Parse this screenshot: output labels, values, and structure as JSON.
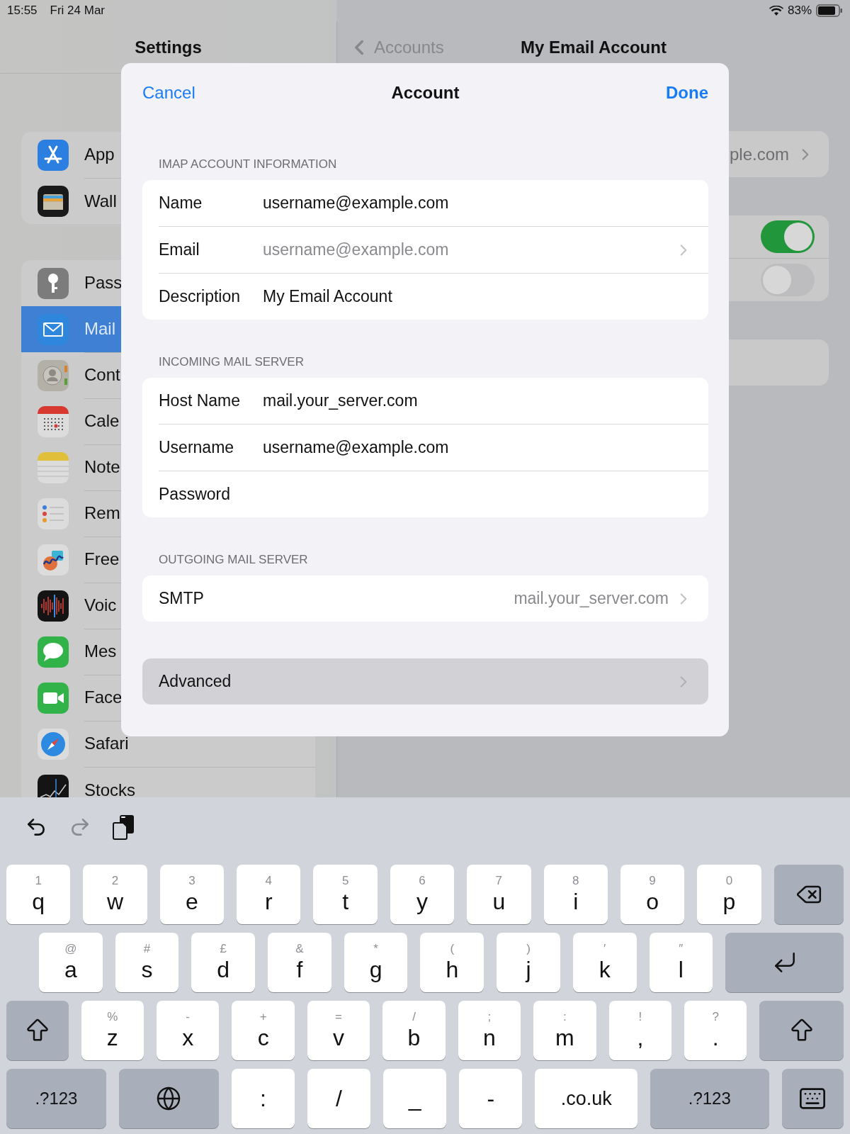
{
  "status_bar": {
    "time": "15:55",
    "date": "Fri 24 Mar",
    "battery": "83%"
  },
  "sidebar": {
    "title": "Settings",
    "groups": [
      [
        {
          "label": "App",
          "kind": "appstore",
          "selected": false
        },
        {
          "label": "Wall",
          "kind": "wallet",
          "selected": false
        }
      ],
      [
        {
          "label": "Pass",
          "kind": "passwords",
          "selected": false
        },
        {
          "label": "Mail",
          "kind": "mail",
          "selected": true
        },
        {
          "label": "Cont",
          "kind": "contacts",
          "selected": false
        },
        {
          "label": "Cale",
          "kind": "calendar",
          "selected": false
        },
        {
          "label": "Note",
          "kind": "notes",
          "selected": false
        },
        {
          "label": "Rem",
          "kind": "reminders",
          "selected": false
        },
        {
          "label": "Free",
          "kind": "freeform",
          "selected": false
        },
        {
          "label": "Voic",
          "kind": "voice",
          "selected": false
        },
        {
          "label": "Mes",
          "kind": "messages",
          "selected": false
        },
        {
          "label": "Face",
          "kind": "facetime",
          "selected": false
        },
        {
          "label": "Safari",
          "kind": "safari",
          "selected": false
        },
        {
          "label": "Stocks",
          "kind": "stocks",
          "selected": false
        }
      ]
    ]
  },
  "detail": {
    "back": "Accounts",
    "title": "My Email Account",
    "cards": [
      {
        "kind": "disclosure",
        "value": "ple.com"
      },
      {
        "kind": "switches",
        "switches": [
          {
            "on": true
          },
          {
            "on": false
          }
        ]
      },
      {
        "kind": "blank"
      }
    ]
  },
  "modal": {
    "cancel": "Cancel",
    "title": "Account",
    "done": "Done",
    "sections": [
      {
        "header": "IMAP ACCOUNT INFORMATION",
        "rows": [
          {
            "kind": "field",
            "label": "Name",
            "value": "username@example.com"
          },
          {
            "kind": "locked",
            "label": "Email",
            "value": "username@example.com"
          },
          {
            "kind": "field",
            "label": "Description",
            "value": "My Email Account"
          }
        ]
      },
      {
        "header": "INCOMING MAIL SERVER",
        "rows": [
          {
            "kind": "field",
            "label": "Host Name",
            "value": "mail.your_server.com"
          },
          {
            "kind": "field",
            "label": "Username",
            "value": "username@example.com"
          },
          {
            "kind": "field",
            "label": "Password"
          }
        ]
      },
      {
        "header": "OUTGOING MAIL SERVER",
        "rows": [
          {
            "kind": "detail",
            "label": "SMTP",
            "value": "mail.your_server.com"
          }
        ]
      },
      {
        "rows": [
          {
            "kind": "nav",
            "label": "Advanced",
            "highlighted": true
          }
        ]
      }
    ]
  },
  "keyboard": {
    "toolbar": [
      {
        "kind": "undo",
        "disabled": false
      },
      {
        "kind": "redo",
        "disabled": true
      },
      {
        "kind": "paste",
        "disabled": false
      }
    ],
    "rows": [
      {
        "keys": [
          {
            "kind": "letter",
            "label": "q",
            "hint": "1"
          },
          {
            "kind": "letter",
            "label": "w",
            "hint": "2"
          },
          {
            "kind": "letter",
            "label": "e",
            "hint": "3"
          },
          {
            "kind": "letter",
            "label": "r",
            "hint": "4"
          },
          {
            "kind": "letter",
            "label": "t",
            "hint": "5"
          },
          {
            "kind": "letter",
            "label": "y",
            "hint": "6"
          },
          {
            "kind": "letter",
            "label": "u",
            "hint": "7"
          },
          {
            "kind": "letter",
            "label": "i",
            "hint": "8"
          },
          {
            "kind": "letter",
            "label": "o",
            "hint": "9"
          },
          {
            "kind": "letter",
            "label": "p",
            "hint": "0"
          },
          {
            "kind": "delete"
          }
        ]
      },
      {
        "keys": [
          {
            "kind": "letter",
            "label": "a",
            "hint": "@"
          },
          {
            "kind": "letter",
            "label": "s",
            "hint": "#"
          },
          {
            "kind": "letter",
            "label": "d",
            "hint": "£"
          },
          {
            "kind": "letter",
            "label": "f",
            "hint": "&"
          },
          {
            "kind": "letter",
            "label": "g",
            "hint": "*"
          },
          {
            "kind": "letter",
            "label": "h",
            "hint": "("
          },
          {
            "kind": "letter",
            "label": "j",
            "hint": ")"
          },
          {
            "kind": "letter",
            "label": "k",
            "hint": "′"
          },
          {
            "kind": "letter",
            "label": "l",
            "hint": "″"
          },
          {
            "kind": "return"
          }
        ]
      },
      {
        "keys": [
          {
            "kind": "shift"
          },
          {
            "kind": "letter",
            "label": "z",
            "hint": "%"
          },
          {
            "kind": "letter",
            "label": "x",
            "hint": "-"
          },
          {
            "kind": "letter",
            "label": "c",
            "hint": "+"
          },
          {
            "kind": "letter",
            "label": "v",
            "hint": "="
          },
          {
            "kind": "letter",
            "label": "b",
            "hint": "/"
          },
          {
            "kind": "letter",
            "label": "n",
            "hint": ";"
          },
          {
            "kind": "letter",
            "label": "m",
            "hint": ":"
          },
          {
            "kind": "letter",
            "label": ",",
            "hint": "!"
          },
          {
            "kind": "letter",
            "label": ".",
            "hint": "?"
          },
          {
            "kind": "shift"
          }
        ]
      },
      {
        "keys": [
          {
            "kind": "mode",
            "label": ".?123"
          },
          {
            "kind": "globe"
          },
          {
            "kind": "char",
            "label": ":"
          },
          {
            "kind": "char",
            "label": "/"
          },
          {
            "kind": "char",
            "label": "_"
          },
          {
            "kind": "char",
            "label": "-"
          },
          {
            "kind": "char",
            "label": ".co.uk"
          },
          {
            "kind": "mode",
            "label": ".?123"
          },
          {
            "kind": "dismiss"
          }
        ]
      }
    ]
  }
}
